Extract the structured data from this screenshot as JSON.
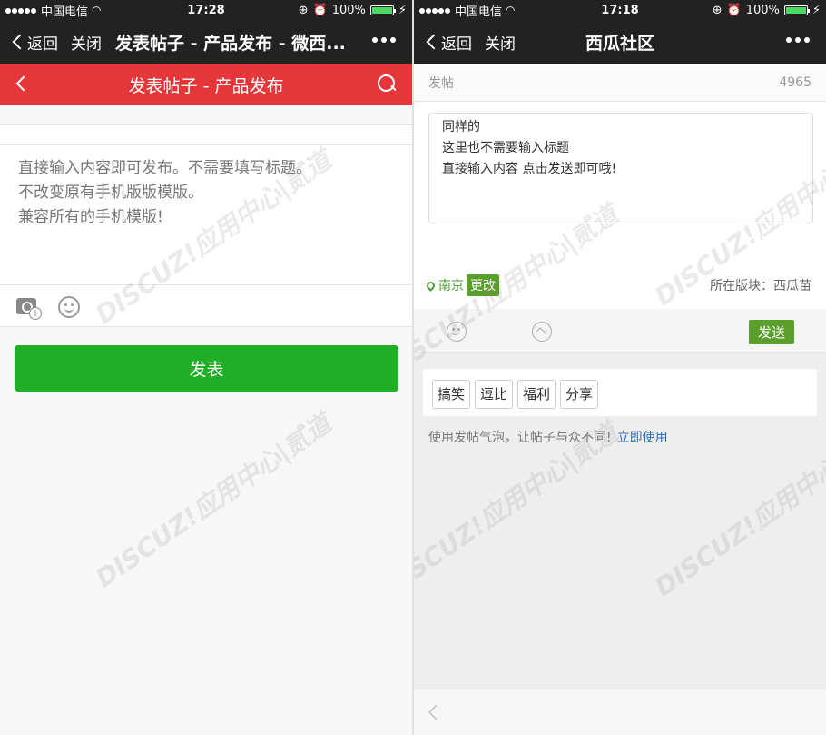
{
  "status_bar": {
    "carrier": "中国电信",
    "battery": "100%",
    "left_time": "17:28",
    "right_time": "17:18"
  },
  "left": {
    "nav": {
      "back": "返回",
      "close": "关闭",
      "title": "发表帖子 - 产品发布 - 微西..."
    },
    "header_title": "发表帖子 - 产品发布",
    "content_lines": [
      "直接输入内容即可发布。不需要填写标题。",
      "不改变原有手机版版模版。",
      "兼容所有的手机模版!"
    ],
    "submit": "发表"
  },
  "right": {
    "nav": {
      "back": "返回",
      "close": "关闭",
      "title": "西瓜社区"
    },
    "post_label": "发帖",
    "char_count": "4965",
    "content_lines": [
      "同样的",
      "这里也不需要输入标题",
      "直接输入内容 点击发送即可哦!"
    ],
    "location": "南京",
    "change": "更改",
    "forum": "所在版块：西瓜苗",
    "send": "发送",
    "tags": [
      "搞笑",
      "逗比",
      "福利",
      "分享"
    ],
    "promo_text": "使用发帖气泡，让帖子与众不同!",
    "promo_link": "立即使用"
  },
  "watermark_text": "DISCUZ!应用中心|贰道"
}
